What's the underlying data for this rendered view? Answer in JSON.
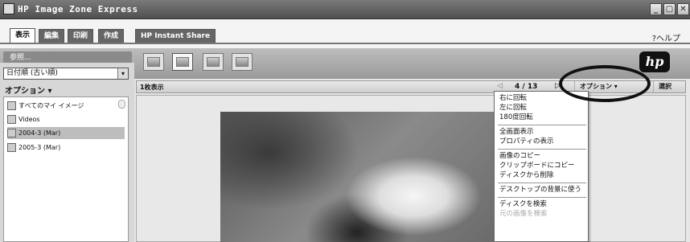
{
  "window": {
    "title": "HP Image Zone Express",
    "minimize": "_",
    "maximize": "▢",
    "close": "✕"
  },
  "tabs": [
    {
      "label": "表示"
    },
    {
      "label": "編集"
    },
    {
      "label": "印刷"
    },
    {
      "label": "作成"
    },
    {
      "label": "HP Instant Share"
    }
  ],
  "help": {
    "label": "ヘルプ"
  },
  "toolbar": {
    "back_label": "参照...",
    "logo": "hp"
  },
  "sidebar": {
    "sort_value": "日付順 (古い順)",
    "sort_arrow": "▾",
    "options_label": "オプション ▾",
    "items": [
      {
        "label": "すべてのマイ イメージ"
      },
      {
        "label": "Videos"
      },
      {
        "label": "2004-3 (Mar)"
      },
      {
        "label": "2005-3 (Mar)"
      }
    ]
  },
  "main": {
    "view_title": "1枚表示",
    "prev": "◁",
    "page_count": "4 / 13",
    "next": "▷",
    "options_button": "オプション ▾",
    "select_button": "選択"
  },
  "menu": {
    "items": [
      {
        "label": "右に回転",
        "enabled": true
      },
      {
        "label": "左に回転",
        "enabled": true
      },
      {
        "label": "180度回転",
        "enabled": true
      },
      {
        "label": "全画面表示",
        "enabled": true
      },
      {
        "label": "プロパティの表示",
        "enabled": true
      },
      {
        "label": "画像のコピー",
        "enabled": true
      },
      {
        "label": "クリップボードにコピー",
        "enabled": true
      },
      {
        "label": "ディスクから削除",
        "enabled": true
      },
      {
        "label": "デスクトップの背景に使う",
        "enabled": true
      },
      {
        "label": "ディスクを検索",
        "enabled": true
      },
      {
        "label": "元の画像を検索",
        "enabled": false
      }
    ]
  }
}
